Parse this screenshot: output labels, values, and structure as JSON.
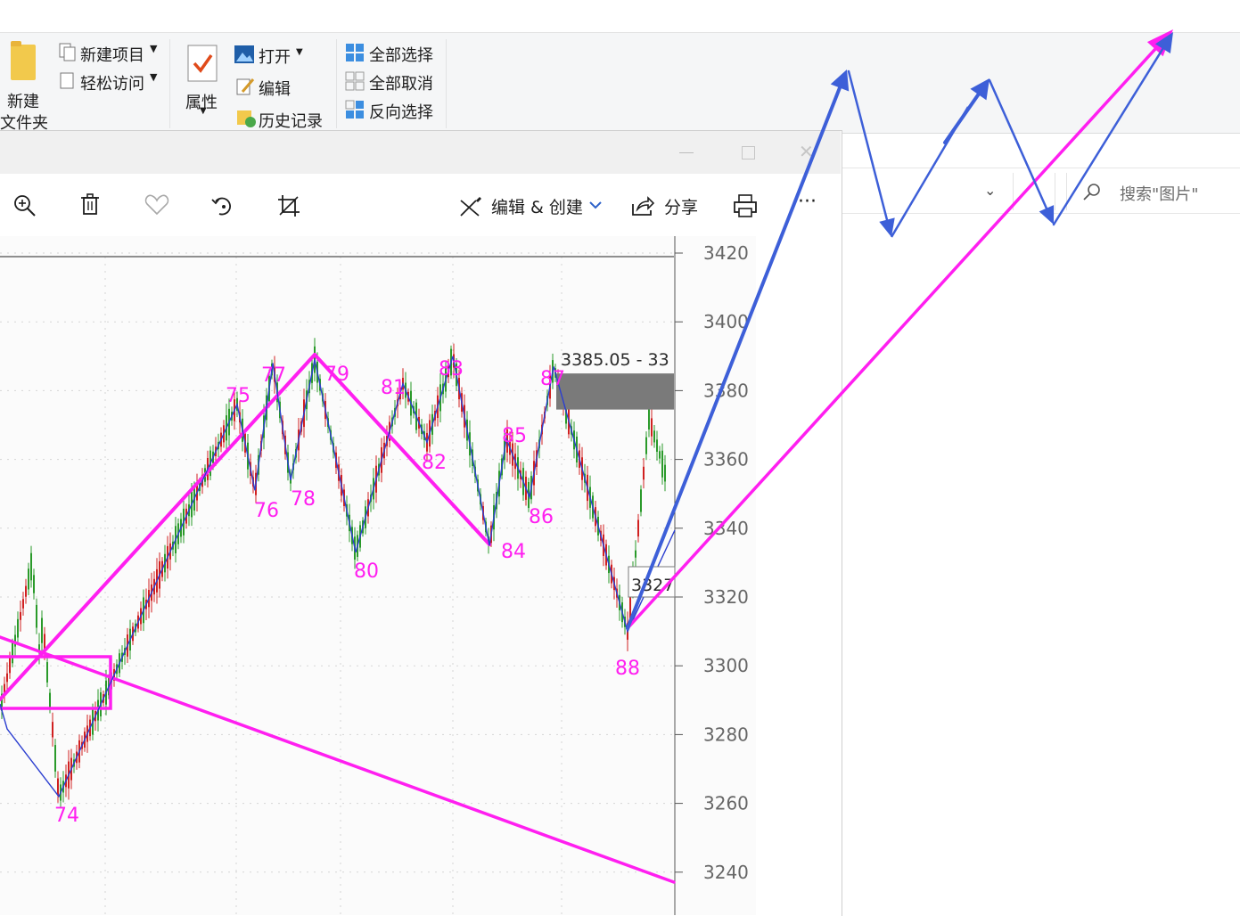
{
  "explorer": {
    "ribbon": {
      "new_folder": [
        "新建",
        "文件夹"
      ],
      "new_item": "新建项目",
      "easy_access": "轻松访问",
      "properties": "属性",
      "open": "打开",
      "edit": "编辑",
      "history": "历史记录",
      "select_all": "全部选择",
      "select_none": "全部取消",
      "invert_selection": "反向选择"
    },
    "search_placeholder": "搜索\"图片\""
  },
  "viewer": {
    "toolbar": {
      "edit_create": "编辑 & 创建",
      "share": "分享",
      "more": "···"
    }
  },
  "colors": {
    "wave": "#2c3fd0",
    "trend": "#ff1ff0",
    "arrow_blue": "#3d5fd8",
    "candle_up": "#d02020",
    "candle_down": "#2a9a2a",
    "zone": "#7a7a7a"
  },
  "chart_data": {
    "type": "candlestick",
    "y_ticks": [
      "3420",
      "3400",
      "3380",
      "3360",
      "3340",
      "3320",
      "3300",
      "3280",
      "3260",
      "3240"
    ],
    "ylim": [
      3236,
      3424
    ],
    "wave_labels": [
      {
        "label": "74",
        "x": 66,
        "y": 3262
      },
      {
        "label": "75",
        "x": 266,
        "y": 3376
      },
      {
        "label": "76",
        "x": 286,
        "y": 3351
      },
      {
        "label": "77",
        "x": 306,
        "y": 3388
      },
      {
        "label": "78",
        "x": 326,
        "y": 3354
      },
      {
        "label": "79",
        "x": 353,
        "y": 3389
      },
      {
        "label": "80",
        "x": 399,
        "y": 3333
      },
      {
        "label": "81",
        "x": 452,
        "y": 3382
      },
      {
        "label": "82",
        "x": 479,
        "y": 3365
      },
      {
        "label": "83",
        "x": 508,
        "y": 3390
      },
      {
        "label": "84",
        "x": 549,
        "y": 3335
      },
      {
        "label": "85",
        "x": 568,
        "y": 3366
      },
      {
        "label": "86",
        "x": 594,
        "y": 3349
      },
      {
        "label": "87",
        "x": 621,
        "y": 3387
      },
      {
        "label": "88",
        "x": 704,
        "y": 3310
      }
    ],
    "zone_label": "3385.05 - 33",
    "zone_range": [
      3374.5,
      3385
    ],
    "price_box_label": "3327"
  }
}
